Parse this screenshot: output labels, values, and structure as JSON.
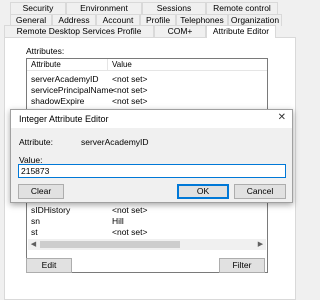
{
  "tabs": {
    "row1": [
      "Security",
      "Environment",
      "Sessions",
      "Remote control"
    ],
    "row2": [
      "General",
      "Address",
      "Account",
      "Profile",
      "Telephones",
      "Organization"
    ],
    "row3": [
      "Remote Desktop Services Profile",
      "COM+",
      "Attribute Editor"
    ]
  },
  "attributes_label": "Attributes:",
  "columns": {
    "attribute": "Attribute",
    "value": "Value"
  },
  "rows_top": [
    {
      "attr": "serverAcademyID",
      "value": "<not set>"
    },
    {
      "attr": "servicePrincipalName",
      "value": "<not set>"
    },
    {
      "attr": "shadowExpire",
      "value": "<not set>"
    }
  ],
  "rows_bottom": [
    {
      "attr": "sIDHistory",
      "value": "<not set>"
    },
    {
      "attr": "sn",
      "value": "Hill"
    },
    {
      "attr": "st",
      "value": "<not set>"
    }
  ],
  "buttons": {
    "edit": "Edit",
    "filter": "Filter"
  },
  "dialog": {
    "title": "Integer Attribute Editor",
    "close_glyph": "✕",
    "attribute_label": "Attribute:",
    "attribute_value": "serverAcademyID",
    "value_label": "Value:",
    "value_input": "215873",
    "clear": "Clear",
    "ok": "OK",
    "cancel": "Cancel"
  },
  "colors": {
    "accent": "#0078d7"
  }
}
